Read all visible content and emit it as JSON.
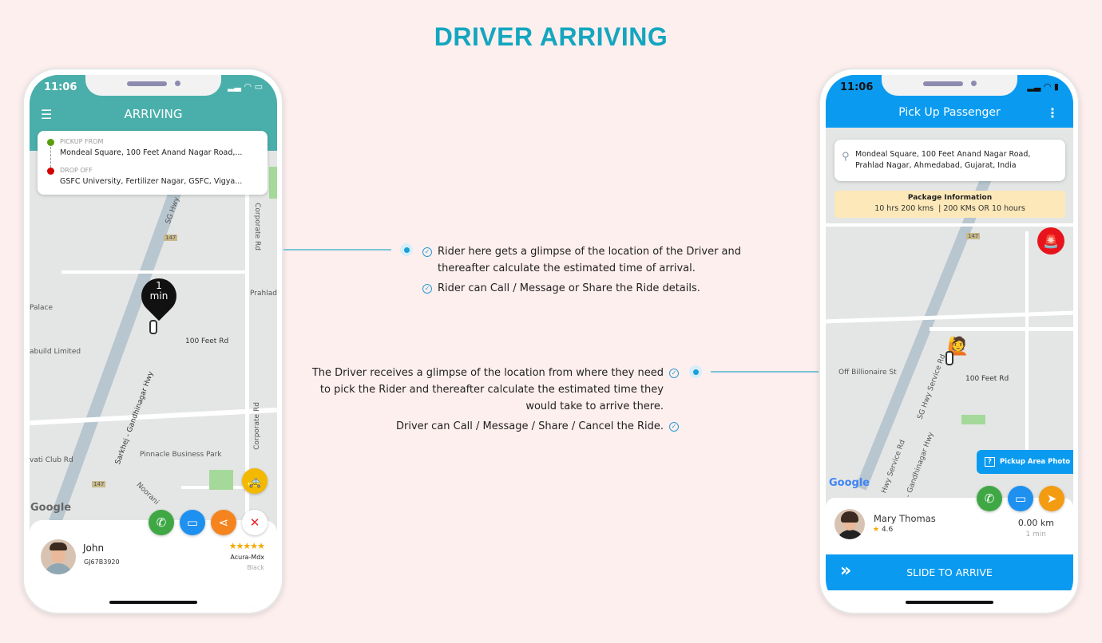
{
  "page_title": "DRIVER ARRIVING",
  "rider_phone": {
    "status_time": "11:06",
    "header_title": "ARRIVING",
    "pickup_label": "PICKUP FROM",
    "pickup_address": "Mondeal Square, 100 Feet Anand Nagar Road,...",
    "dropoff_label": "DROP OFF",
    "dropoff_address": "GSFC University, Fertilizer Nagar, GSFC, Vigya...",
    "eta_pin": {
      "value": "1",
      "unit": "min"
    },
    "map_labels": [
      "SG Hwy",
      "Corporate Rd",
      "147",
      "Prahlad",
      "Palace",
      "100 Feet Rd",
      "abuild Limited",
      "Sarkhej - Gandhinagar Hwy",
      "Corporate Rd",
      "Pinnacle Business Park",
      "vati Club Rd",
      "Noorani",
      "147"
    ],
    "map_brand": "Google",
    "driver": {
      "name": "John",
      "plate": "GJ67B3920",
      "car_model": "Acura-Mdx",
      "car_color": "Black",
      "rating": 4.5
    },
    "actions": [
      "call",
      "message",
      "share",
      "cancel"
    ],
    "header_color": "#4aafab"
  },
  "annotations": {
    "rider": [
      "Rider here gets a glimpse of the location of the Driver and thereafter calculate the estimated time of arrival.",
      "Rider can Call / Message or Share the Ride details."
    ],
    "driver": [
      "The Driver receives a glimpse of the location from where they need to pick the Rider and thereafter calculate the estimated time they would take to arrive there.",
      "Driver can Call / Message / Share / Cancel the Ride."
    ]
  },
  "driver_phone": {
    "status_time": "11:06",
    "header_title": "Pick Up Passenger",
    "address": "Mondeal Square, 100 Feet Anand Nagar Road, Prahlad Nagar, Ahmedabad, Gujarat, India",
    "package_title": "Package Information",
    "package_detail": "10 hrs 200 kms  | 200 KMs OR 10 hours",
    "map_labels": [
      "147",
      "SG Hwy Service Rd",
      "Off Billionaire St",
      "100 Feet Rd",
      "Hwy Service Rd",
      "khej - Gandhinagar Hwy"
    ],
    "map_brand": "Google",
    "pickup_photo_label": "Pickup Area Photo",
    "passenger": {
      "name": "Mary Thomas",
      "rating": "4.6",
      "distance": "0.00 km",
      "eta": "1 min"
    },
    "slide_label": "SLIDE TO ARRIVE",
    "header_color": "#0a9bf0"
  }
}
